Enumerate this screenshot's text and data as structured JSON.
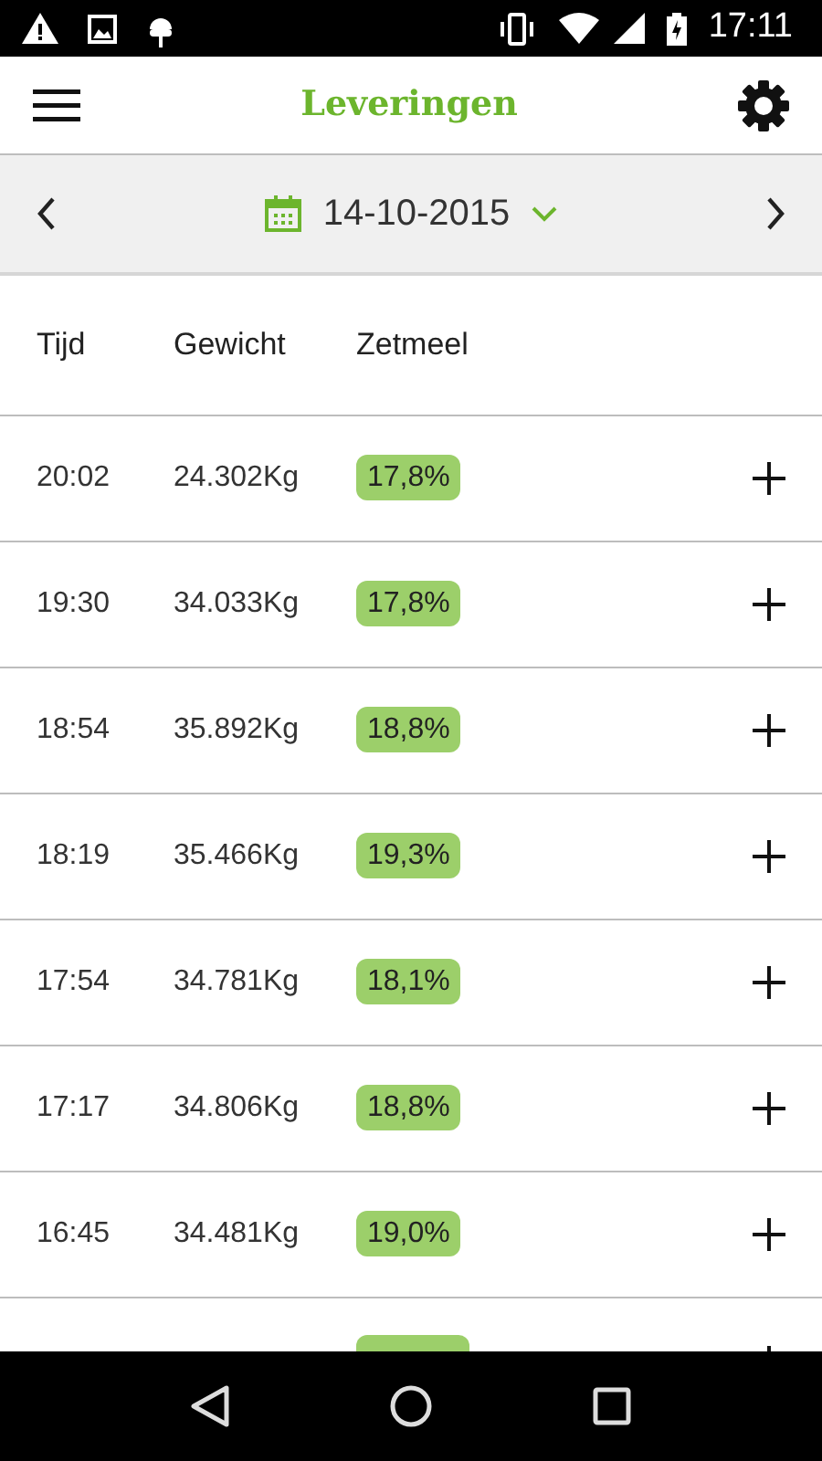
{
  "status_bar": {
    "time": "17:11"
  },
  "app_bar": {
    "title": "Leveringen"
  },
  "date_bar": {
    "date": "14-10-2015"
  },
  "table": {
    "columns": [
      "Tijd",
      "Gewicht",
      "Zetmeel"
    ],
    "rows": [
      {
        "time": "20:02",
        "weight": "24.302Kg",
        "starch": "17,8%"
      },
      {
        "time": "19:30",
        "weight": "34.033Kg",
        "starch": "17,8%"
      },
      {
        "time": "18:54",
        "weight": "35.892Kg",
        "starch": "18,8%"
      },
      {
        "time": "18:19",
        "weight": "35.466Kg",
        "starch": "19,3%"
      },
      {
        "time": "17:54",
        "weight": "34.781Kg",
        "starch": "18,1%"
      },
      {
        "time": "17:17",
        "weight": "34.806Kg",
        "starch": "18,8%"
      },
      {
        "time": "16:45",
        "weight": "34.481Kg",
        "starch": "19,0%"
      }
    ]
  }
}
